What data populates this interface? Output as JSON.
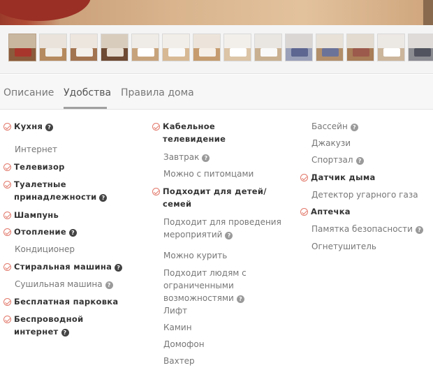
{
  "tabs": [
    "Описание",
    "Удобства",
    "Правила дома"
  ],
  "thumbnails": [
    {
      "wall": "#c9b7a0",
      "floor": "#8a5b3c",
      "bed": "#a8362c"
    },
    {
      "wall": "#e9e3dc",
      "floor": "#b58a5e",
      "bed": "#f2eee9"
    },
    {
      "wall": "#ede6de",
      "floor": "#a37450",
      "bed": "#f4f0ec"
    },
    {
      "wall": "#d8ccbd",
      "floor": "#6f4a34",
      "bed": "#e7ddd1"
    },
    {
      "wall": "#efebe6",
      "floor": "#c7a37c",
      "bed": "#ffffff"
    },
    {
      "wall": "#f1ede8",
      "floor": "#d7b995",
      "bed": "#fafafa"
    },
    {
      "wall": "#ece4da",
      "floor": "#c69c6f",
      "bed": "#f5efe8"
    },
    {
      "wall": "#f2efeb",
      "floor": "#dcc4a6",
      "bed": "#ffffff"
    },
    {
      "wall": "#e9e6e2",
      "floor": "#c9b091",
      "bed": "#f9f9f9"
    },
    {
      "wall": "#d9d6d4",
      "floor": "#9aa0b8",
      "bed": "#5c6690"
    },
    {
      "wall": "#e7e1d8",
      "floor": "#b28f6a",
      "bed": "#6c7399"
    },
    {
      "wall": "#e3dbcf",
      "floor": "#a87d57",
      "bed": "#9c5a4c"
    },
    {
      "wall": "#ece8e4",
      "floor": "#cbb59b",
      "bed": "#ffffff"
    },
    {
      "wall": "#dedbd8",
      "floor": "#8b8b92",
      "bed": "#51535e"
    }
  ],
  "amenities": {
    "col1": [
      {
        "label": "Кухня",
        "available": true,
        "help": true
      },
      {
        "label": "Интернет",
        "available": false,
        "help": false
      },
      {
        "label": "Телевизор",
        "available": true,
        "help": false
      },
      {
        "label": "Туалетные",
        "label2": "принадлежности",
        "available": true,
        "help": true
      },
      {
        "label": "Шампунь",
        "available": true,
        "help": false
      },
      {
        "label": "Отопление",
        "available": true,
        "help": true
      },
      {
        "label": "Кондиционер",
        "available": false,
        "help": false
      },
      {
        "label": "Стиральная машина",
        "available": true,
        "help": true
      },
      {
        "label": "Сушильная машина",
        "available": false,
        "help": true
      },
      {
        "label": "Бесплатная парковка",
        "available": true,
        "help": false
      },
      {
        "label": "Беспроводной",
        "label2": "интернет",
        "available": true,
        "help": true
      }
    ],
    "col2": [
      {
        "label": "Кабельное",
        "label2": "телевидение",
        "available": true,
        "help": false
      },
      {
        "label": "Завтрак",
        "available": false,
        "help": true
      },
      {
        "label": "Можно с питомцами",
        "available": false,
        "help": false
      },
      {
        "label": "Подходит для детей/",
        "label2": "семей",
        "available": true,
        "help": false
      },
      {
        "label": "Подходит для проведения",
        "label2": "мероприятий",
        "available": false,
        "help": true
      },
      {
        "label": "Можно курить",
        "available": false,
        "help": false
      },
      {
        "label": "Подходит людям с",
        "label2": "ограниченными",
        "label3": "возможностями",
        "available": false,
        "help": true
      },
      {
        "label": "Лифт",
        "available": false,
        "help": false
      },
      {
        "label": "Камин",
        "available": false,
        "help": false
      },
      {
        "label": "Домофон",
        "available": false,
        "help": false
      },
      {
        "label": "Вахтер",
        "available": false,
        "help": false
      }
    ],
    "col3": [
      {
        "label": "Бассейн",
        "available": false,
        "help": true
      },
      {
        "label": "Джакузи",
        "available": false,
        "help": false
      },
      {
        "label": "Спортзал",
        "available": false,
        "help": true
      },
      {
        "label": "Датчик дыма",
        "available": true,
        "help": false
      },
      {
        "label": "Детектор угарного газа",
        "available": false,
        "help": false
      },
      {
        "label": "Аптечка",
        "available": true,
        "help": false
      },
      {
        "label": "Памятка безопасности",
        "available": false,
        "help": true
      },
      {
        "label": "Огнетушитель",
        "available": false,
        "help": false
      }
    ]
  },
  "colors": {
    "check": "#e2786a",
    "text_dark": "#333333",
    "text_muted": "#777777"
  }
}
